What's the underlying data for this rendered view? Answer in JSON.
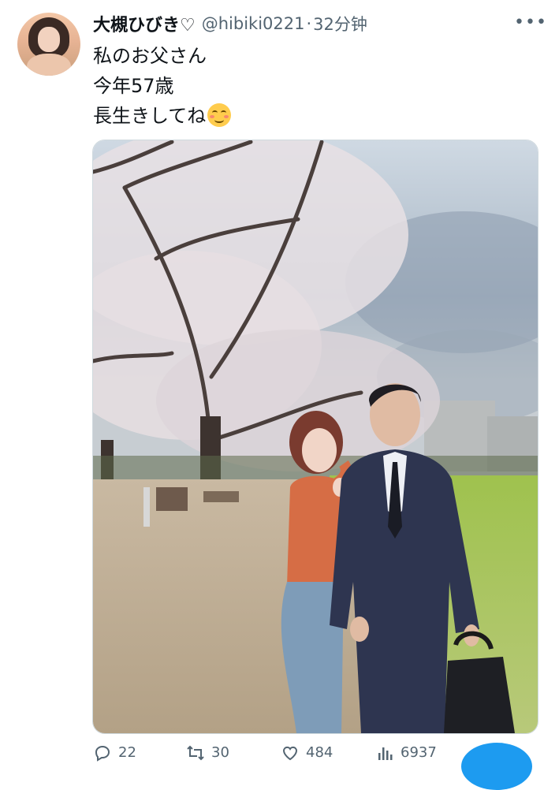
{
  "user": {
    "display_name": "大槻ひびき♡",
    "handle": "@hibiki0221",
    "separator": "·",
    "time": "32分钟"
  },
  "tweet": {
    "lines": [
      "私のお父さん",
      "今年57歳",
      "長生きしてね"
    ]
  },
  "media": {
    "icon": "photo"
  },
  "actions": {
    "replies": "22",
    "retweets": "30",
    "likes": "484",
    "views": "6937"
  },
  "colors": {
    "text": "#0f1419",
    "secondary": "#536471",
    "accent": "#1d9bf0"
  }
}
